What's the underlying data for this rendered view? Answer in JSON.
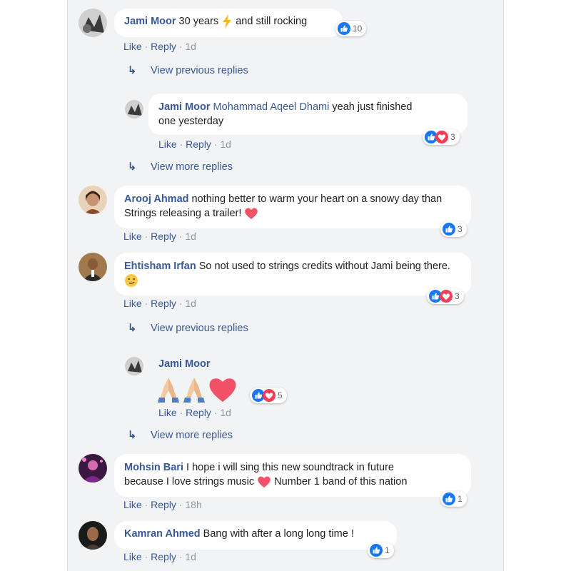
{
  "comments": [
    {
      "author": "Jami Moor",
      "text_before": "30 years",
      "text_after": "and still rocking",
      "emoji": "lightning-icon",
      "reactions": {
        "types": [
          "like"
        ],
        "count": "10"
      },
      "actions": {
        "like": "Like",
        "reply": "Reply",
        "time": "1d"
      }
    },
    {
      "author": "Arooj Ahmad",
      "text": "nothing better to warm your heart on a snowy day than Strings releasing a trailer!",
      "emoji": "heart-icon",
      "reactions": {
        "types": [
          "like"
        ],
        "count": "3"
      },
      "actions": {
        "like": "Like",
        "reply": "Reply",
        "time": "1d"
      }
    },
    {
      "author": "Ehtisham Irfan",
      "text": "So not used to strings credits without Jami being there.",
      "emoji": "smirk-face-icon",
      "reactions": {
        "types": [
          "like",
          "love"
        ],
        "count": "3"
      },
      "actions": {
        "like": "Like",
        "reply": "Reply",
        "time": "1d"
      }
    },
    {
      "author": "Mohsin Bari",
      "text_line1": "I hope i will sing this new soundtrack in future",
      "text_line2_before": "because I love strings music",
      "text_line2_after": "Number 1 band of this nation",
      "emoji": "heart-icon",
      "reactions": {
        "types": [
          "like"
        ],
        "count": "1"
      },
      "actions": {
        "like": "Like",
        "reply": "Reply",
        "time": "18h"
      }
    },
    {
      "author": "Kamran Ahmed",
      "text": "Bang with after a long long time !",
      "reactions": {
        "types": [
          "like"
        ],
        "count": "1"
      },
      "actions": {
        "like": "Like",
        "reply": "Reply",
        "time": "1d"
      }
    }
  ],
  "replies": [
    {
      "author": "Jami Moor",
      "mention": "Mohammad Aqeel Dhami",
      "text_line1": "yeah just finished",
      "text_line2": "one yesterday",
      "reactions": {
        "types": [
          "like",
          "love"
        ],
        "count": "3"
      },
      "actions": {
        "like": "Like",
        "reply": "Reply",
        "time": "1d"
      }
    },
    {
      "author": "Jami Moor",
      "emojis": [
        "folded-hands-icon",
        "folded-hands-icon",
        "heart-icon"
      ],
      "reactions": {
        "types": [
          "like",
          "love"
        ],
        "count": "5"
      },
      "actions": {
        "like": "Like",
        "reply": "Reply",
        "time": "1d"
      }
    }
  ],
  "links": {
    "view_previous_1": "View previous replies",
    "view_more_1": "View more replies",
    "view_previous_2": "View previous replies",
    "view_more_2": "View more replies"
  },
  "separator": "·",
  "colors": {
    "link": "#385898",
    "meta": "#90949c",
    "panel_bg": "#f2f3f5",
    "like_blue": "#1877f2",
    "love_red": "#f33e58"
  }
}
